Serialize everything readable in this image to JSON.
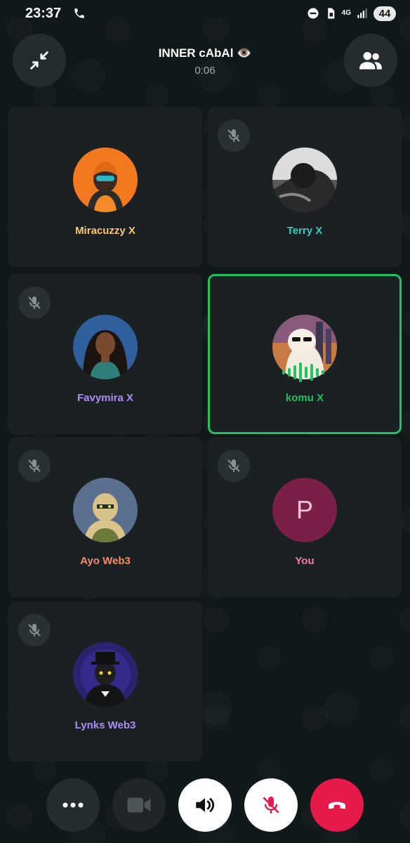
{
  "status_bar": {
    "time": "23:37",
    "network_label": "4G",
    "battery": "44"
  },
  "header": {
    "title": "INNER cAbAl 👁️",
    "timer": "0:06"
  },
  "participants": [
    {
      "name": "Miracuzzy X",
      "name_color": "#f8c76c",
      "muted": false,
      "speaking": false
    },
    {
      "name": "Terry X",
      "name_color": "#3fc8be",
      "muted": true,
      "speaking": false
    },
    {
      "name": "Favymira X",
      "name_color": "#a98ef7",
      "muted": true,
      "speaking": false
    },
    {
      "name": "komu X",
      "name_color": "#21c063",
      "muted": false,
      "speaking": true
    },
    {
      "name": "Ayo Web3",
      "name_color": "#f48b66",
      "muted": true,
      "speaking": false
    },
    {
      "name": "You",
      "name_color": "#f67aa3",
      "muted": true,
      "speaking": false,
      "avatar_letter": "P"
    },
    {
      "name": "Lynks Web3",
      "name_color": "#a98ef7",
      "muted": true,
      "speaking": false
    }
  ],
  "controls": {
    "more": "more-options",
    "video": "video-camera (disabled)",
    "speaker": "speaker-on",
    "mic": "mic-muted",
    "end": "end-call"
  },
  "colors": {
    "accent_green": "#21c063",
    "end_call_red": "#e51a4a",
    "tile_bg": "#1b2123"
  }
}
